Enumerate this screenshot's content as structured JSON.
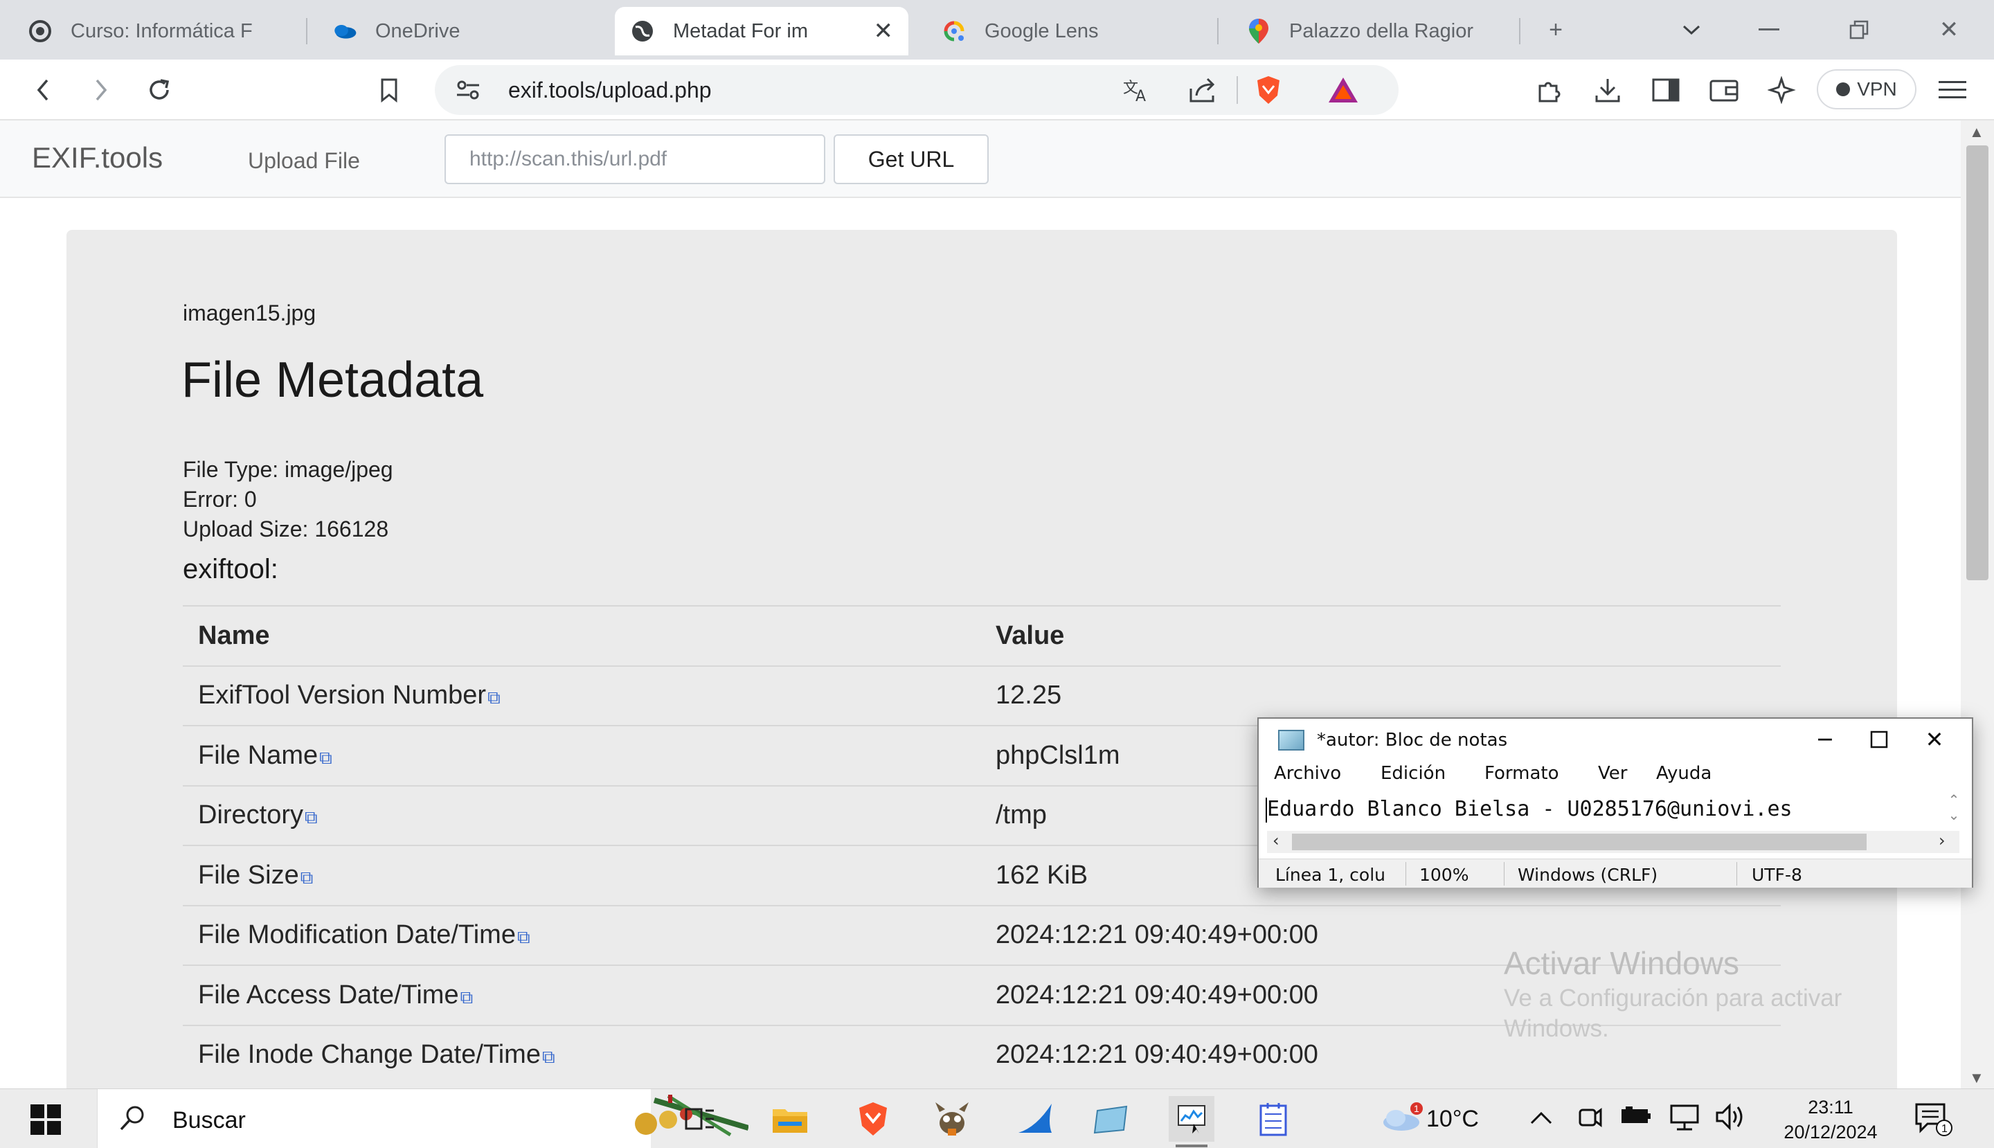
{
  "browser": {
    "tabs": [
      {
        "title": "Curso: Informática F",
        "icon": "moodle-icon"
      },
      {
        "title": "OneDrive",
        "icon": "onedrive-cloud-icon"
      },
      {
        "title": "Metadat For im",
        "icon": "globe-icon",
        "active": true
      },
      {
        "title": "Google Lens",
        "icon": "google-lens-icon"
      },
      {
        "title": "Palazzo della Ragior",
        "icon": "maps-pin-icon"
      }
    ],
    "url": "exif.tools/upload.php",
    "vpn_label": "VPN"
  },
  "site": {
    "brand": "EXIF.tools",
    "upload_link": "Upload File",
    "url_placeholder": "http://scan.this/url.pdf",
    "get_url_button": "Get URL"
  },
  "report": {
    "filename": "imagen15.jpg",
    "heading": "File Metadata",
    "file_type": "File Type: image/jpeg",
    "error": "Error: 0",
    "upload_size": "Upload Size: 166128",
    "tool_label": "exiftool:",
    "columns": [
      "Name",
      "Value"
    ],
    "rows": [
      {
        "name": "ExifTool Version Number",
        "value": "12.25"
      },
      {
        "name": "File Name",
        "value": "phpClsl1m"
      },
      {
        "name": "Directory",
        "value": "/tmp"
      },
      {
        "name": "File Size",
        "value": "162 KiB"
      },
      {
        "name": "File Modification Date/Time",
        "value": "2024:12:21 09:40:49+00:00"
      },
      {
        "name": "File Access Date/Time",
        "value": "2024:12:21 09:40:49+00:00"
      },
      {
        "name": "File Inode Change Date/Time",
        "value": "2024:12:21 09:40:49+00:00"
      }
    ]
  },
  "watermark": {
    "title": "Activar Windows",
    "subtitle": "Ve a Configuración para activar Windows."
  },
  "notepad": {
    "title": "*autor: Bloc de notas",
    "menu": [
      "Archivo",
      "Edición",
      "Formato",
      "Ver",
      "Ayuda"
    ],
    "content": "Eduardo Blanco Bielsa - U0285176@uniovi.es",
    "status": {
      "position": "Línea 1, colu",
      "zoom": "100%",
      "line_ending": "Windows (CRLF)",
      "encoding": "UTF-8"
    }
  },
  "taskbar": {
    "search_label": "Buscar",
    "temperature": "10°C",
    "weather_badge": "1",
    "time": "23:11",
    "date": "20/12/2024",
    "notification_count": "1"
  },
  "colors": {
    "tab_strip": "#dfe1e5",
    "card_bg": "#ebebeb",
    "brave_orange": "#fb542b",
    "link_blue": "#3366cc"
  }
}
